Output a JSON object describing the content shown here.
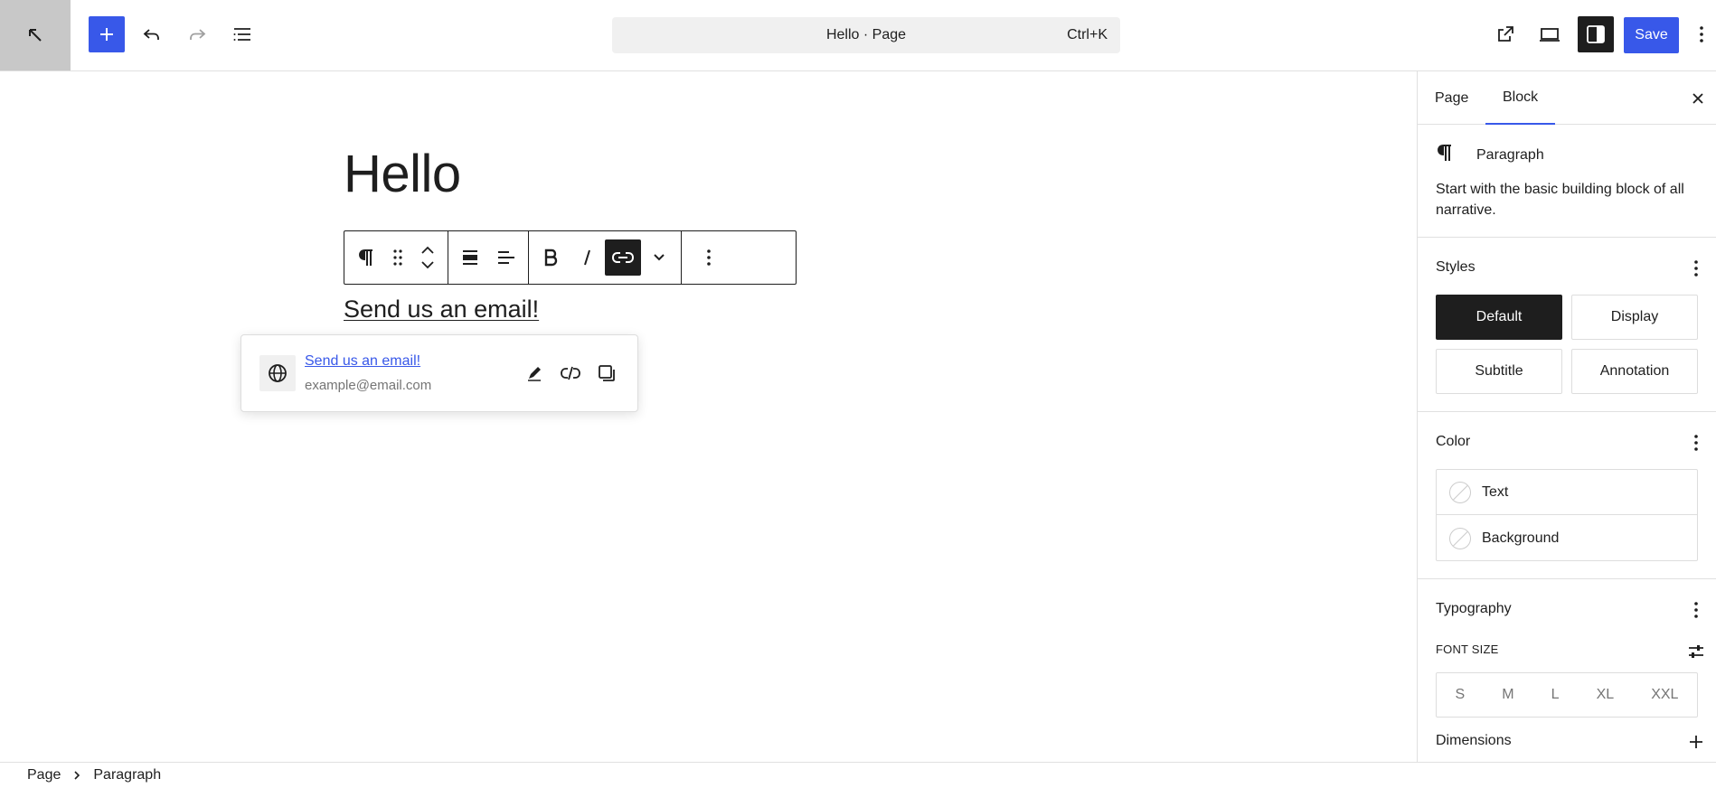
{
  "header": {
    "command_title": "Hello · Page",
    "command_shortcut": "Ctrl+K",
    "save_label": "Save"
  },
  "editor": {
    "post_title": "Hello",
    "paragraph_text": "Send us an email!"
  },
  "link_popover": {
    "link_title": "Send us an email!",
    "link_url": "example@email.com"
  },
  "sidebar": {
    "tabs": [
      "Page",
      "Block"
    ],
    "active_tab": "Block",
    "block": {
      "name": "Paragraph",
      "description": "Start with the basic building block of all narrative."
    },
    "styles": {
      "title": "Styles",
      "options": [
        "Default",
        "Display",
        "Subtitle",
        "Annotation"
      ],
      "selected": "Default"
    },
    "color": {
      "title": "Color",
      "items": [
        "Text",
        "Background"
      ]
    },
    "typography": {
      "title": "Typography",
      "font_size_label": "FONT SIZE",
      "sizes": [
        "S",
        "M",
        "L",
        "XL",
        "XXL"
      ]
    },
    "dimensions": {
      "title": "Dimensions"
    }
  },
  "breadcrumb": [
    "Page",
    "Paragraph"
  ],
  "colors": {
    "accent": "#3858e9",
    "dark": "#1e1e1e",
    "site_icon_bg": "#c8c8c8"
  }
}
